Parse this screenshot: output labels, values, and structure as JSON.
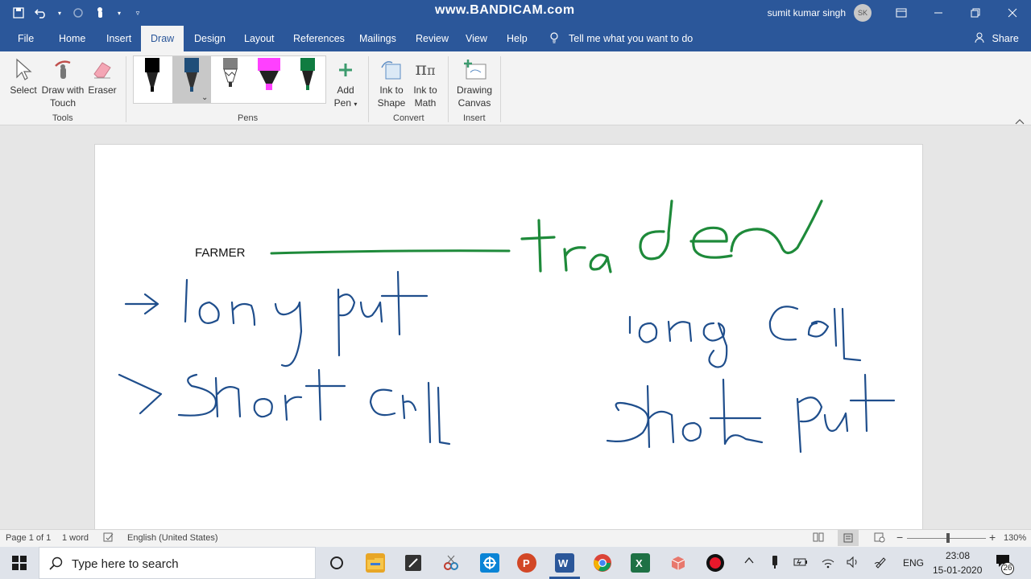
{
  "title_bar": {
    "watermark": "www.BANDICAM.com",
    "user_name": "sumit kumar singh",
    "avatar_initials": "SK",
    "window_buttons": [
      "ribbon-display-options",
      "minimize",
      "restore",
      "close"
    ]
  },
  "tabs": [
    {
      "label": "File",
      "active": false
    },
    {
      "label": "Home",
      "active": false
    },
    {
      "label": "Insert",
      "active": false
    },
    {
      "label": "Draw",
      "active": true
    },
    {
      "label": "Design",
      "active": false
    },
    {
      "label": "Layout",
      "active": false
    },
    {
      "label": "References",
      "active": false
    },
    {
      "label": "Mailings",
      "active": false
    },
    {
      "label": "Review",
      "active": false
    },
    {
      "label": "View",
      "active": false
    },
    {
      "label": "Help",
      "active": false
    }
  ],
  "tell_me": "Tell me what you want to do",
  "share": "Share",
  "ribbon": {
    "tools": {
      "group": "Tools",
      "select": "Select",
      "draw_touch_1": "Draw with",
      "draw_touch_2": "Touch",
      "eraser": "Eraser"
    },
    "pens": {
      "group": "Pens",
      "colors": [
        "#000000",
        "#1f4e79",
        "#7f7f7f",
        "#ff40ff",
        "#107c41"
      ],
      "add_pen_1": "Add",
      "add_pen_2": "Pen"
    },
    "convert": {
      "group": "Convert",
      "ink_shape_1": "Ink to",
      "ink_shape_2": "Shape",
      "ink_math_1": "Ink to",
      "ink_math_2": "Math"
    },
    "insert": {
      "group": "Insert",
      "canvas_1": "Drawing",
      "canvas_2": "Canvas"
    }
  },
  "document": {
    "typed_text": "FARMER",
    "ink_words": [
      "trader",
      "long put",
      "short call",
      "long Call",
      "Short Put"
    ],
    "ink_colors": {
      "green": "#1e8a3a",
      "blue": "#1f4e8c"
    }
  },
  "status_bar": {
    "page": "Page 1 of 1",
    "words": "1 word",
    "language": "English (United States)",
    "zoom": "130%"
  },
  "taskbar": {
    "search_placeholder": "Type here to search",
    "language": "ENG",
    "time": "23:08",
    "date": "15-01-2020",
    "notifications": "26"
  }
}
